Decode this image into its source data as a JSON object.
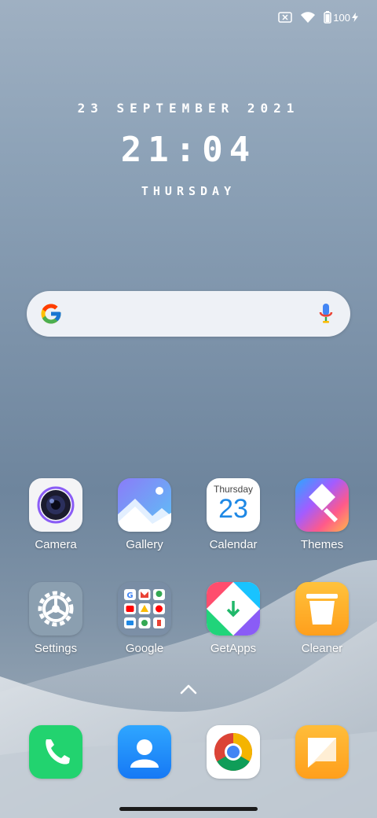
{
  "status_bar": {
    "battery_level": "100",
    "icons": [
      "sim-disabled-icon",
      "wifi-icon",
      "battery-charging-icon"
    ]
  },
  "clock_widget": {
    "date": "23 SEPTEMBER 2021",
    "time": "21:04",
    "day": "THURSDAY"
  },
  "search": {
    "icons": [
      "google-g-icon",
      "microphone-icon"
    ]
  },
  "apps": [
    {
      "label": "Camera",
      "icon": "camera-icon"
    },
    {
      "label": "Gallery",
      "icon": "gallery-icon"
    },
    {
      "label": "Calendar",
      "icon": "calendar-icon",
      "icon_day_label": "Thursday",
      "icon_date": "23"
    },
    {
      "label": "Themes",
      "icon": "themes-brush-icon"
    },
    {
      "label": "Settings",
      "icon": "settings-gear-icon"
    },
    {
      "label": "Google",
      "icon": "google-folder-icon"
    },
    {
      "label": "GetApps",
      "icon": "getapps-icon"
    },
    {
      "label": "Cleaner",
      "icon": "trash-icon"
    }
  ],
  "dock": [
    {
      "icon": "phone-icon"
    },
    {
      "icon": "contacts-icon"
    },
    {
      "icon": "chrome-icon"
    },
    {
      "icon": "messages-icon"
    }
  ],
  "colors": {
    "phone": "#22d36f",
    "contacts": "#1e90ff",
    "messages": "#ffad2b",
    "cleaner": "#ffb02e"
  }
}
